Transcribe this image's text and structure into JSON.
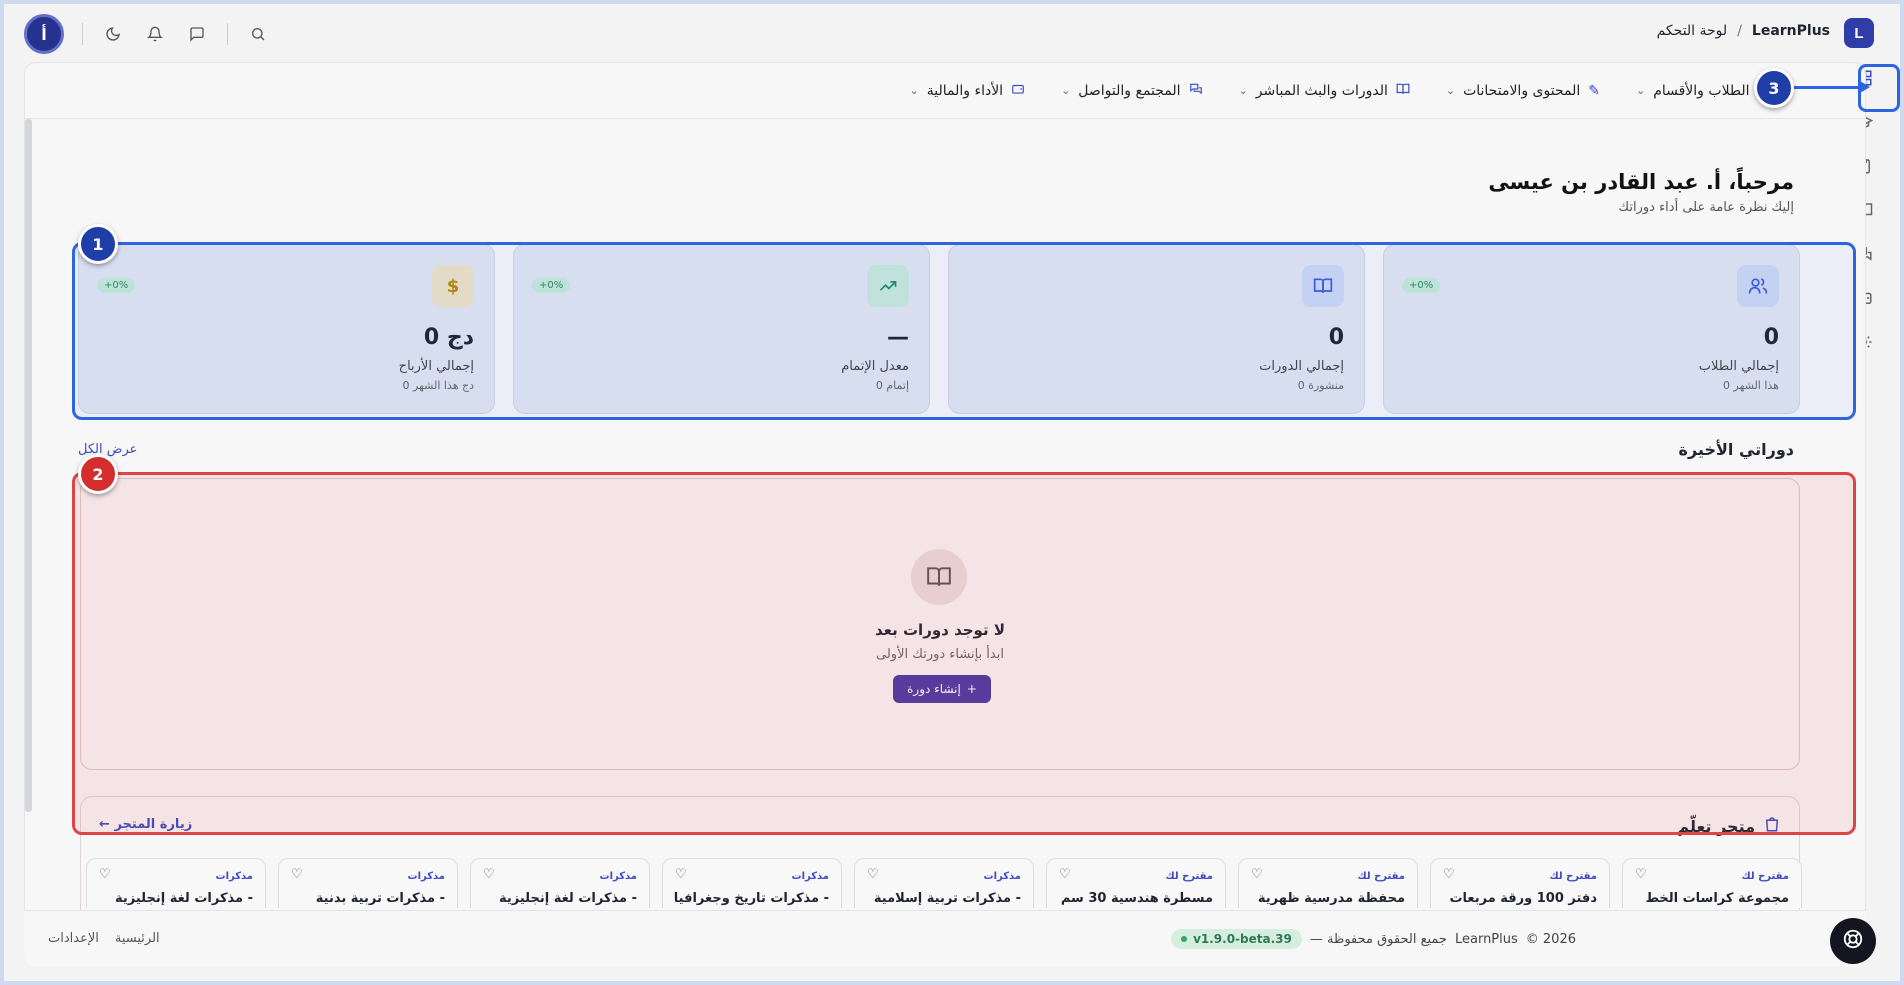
{
  "header": {
    "brand_initial": "L",
    "brand": "LearnPlus",
    "separator": "/",
    "crumb": "لوحة التحكم",
    "user_initial": "أ"
  },
  "nav": [
    {
      "label": "الطلاب والأقسام",
      "icon": "graduation-icon"
    },
    {
      "label": "المحتوى والامتحانات",
      "icon": "edit-icon"
    },
    {
      "label": "الدورات والبث المباشر",
      "icon": "book-icon"
    },
    {
      "label": "المجتمع والتواصل",
      "icon": "chat-icon"
    },
    {
      "label": "الأداء والمالية",
      "icon": "wallet-icon"
    }
  ],
  "welcome": {
    "title": "مرحباً، أ. عبد القادر بن عيسى",
    "subtitle": "إليك نظرة عامة على أداء دوراتك"
  },
  "stats": [
    {
      "value": "0",
      "label": "إجمالي الطلاب",
      "sub": "0 هذا الشهر",
      "trend": "+0%",
      "icon": "users-icon",
      "color": "#3b5bdb",
      "bg": "#cdd8f5"
    },
    {
      "value": "0",
      "label": "إجمالي الدورات",
      "sub": "0 منشورة",
      "trend": "",
      "icon": "book-icon",
      "color": "#3b5bdb",
      "bg": "#cdd8f5"
    },
    {
      "value": "—",
      "label": "معدل الإتمام",
      "sub": "0 إتمام",
      "trend": "+0%",
      "icon": "trending-up-icon",
      "color": "#1f8a6a",
      "bg": "#c9eadb"
    },
    {
      "value": "0 دج",
      "label": "إجمالي الأرباح",
      "sub": "0 دج هذا الشهر",
      "trend": "+0%",
      "icon": "dollar-icon",
      "color": "#b8860b",
      "bg": "#efe3c7"
    }
  ],
  "recent": {
    "title": "دوراتي الأخيرة",
    "view_all": "عرض الكل",
    "empty_title": "لا توجد دورات بعد",
    "empty_sub": "ابدأ بإنشاء دورتك الأولى",
    "create_label": "إنشاء دورة"
  },
  "store": {
    "title": "متجر تعلّم",
    "visit": "زيارة المتجر",
    "products": [
      {
        "tag": "مقترح لك",
        "name": "مجموعة كراسات الخط"
      },
      {
        "tag": "مقترح لك",
        "name": "دفتر 100 ورقة مربعات"
      },
      {
        "tag": "مقترح لك",
        "name": "محفظة مدرسية ظهرية"
      },
      {
        "tag": "مقترح لك",
        "name": "مسطرة هندسية 30 سم"
      },
      {
        "tag": "مذكرات",
        "name": "مذكرات تربية إسلامية -"
      },
      {
        "tag": "مذكرات",
        "name": "مذكرات تاريخ وجغرافيا -"
      },
      {
        "tag": "مذكرات",
        "name": "مذكرات لغة إنجليزية -"
      },
      {
        "tag": "مذكرات",
        "name": "مذكرات تربية بدنية -"
      },
      {
        "tag": "مذكرات",
        "name": "مذكرات لغة إنجليزية -"
      }
    ]
  },
  "footer": {
    "copyright": "© 2026",
    "brand": "LearnPlus",
    "rights": "— جميع الحقوق محفوظة",
    "version": "v1.9.0-beta.39",
    "home": "الرئيسية",
    "settings": "الإعدادات"
  },
  "annotations": {
    "one": "1",
    "two": "2",
    "three": "3"
  }
}
